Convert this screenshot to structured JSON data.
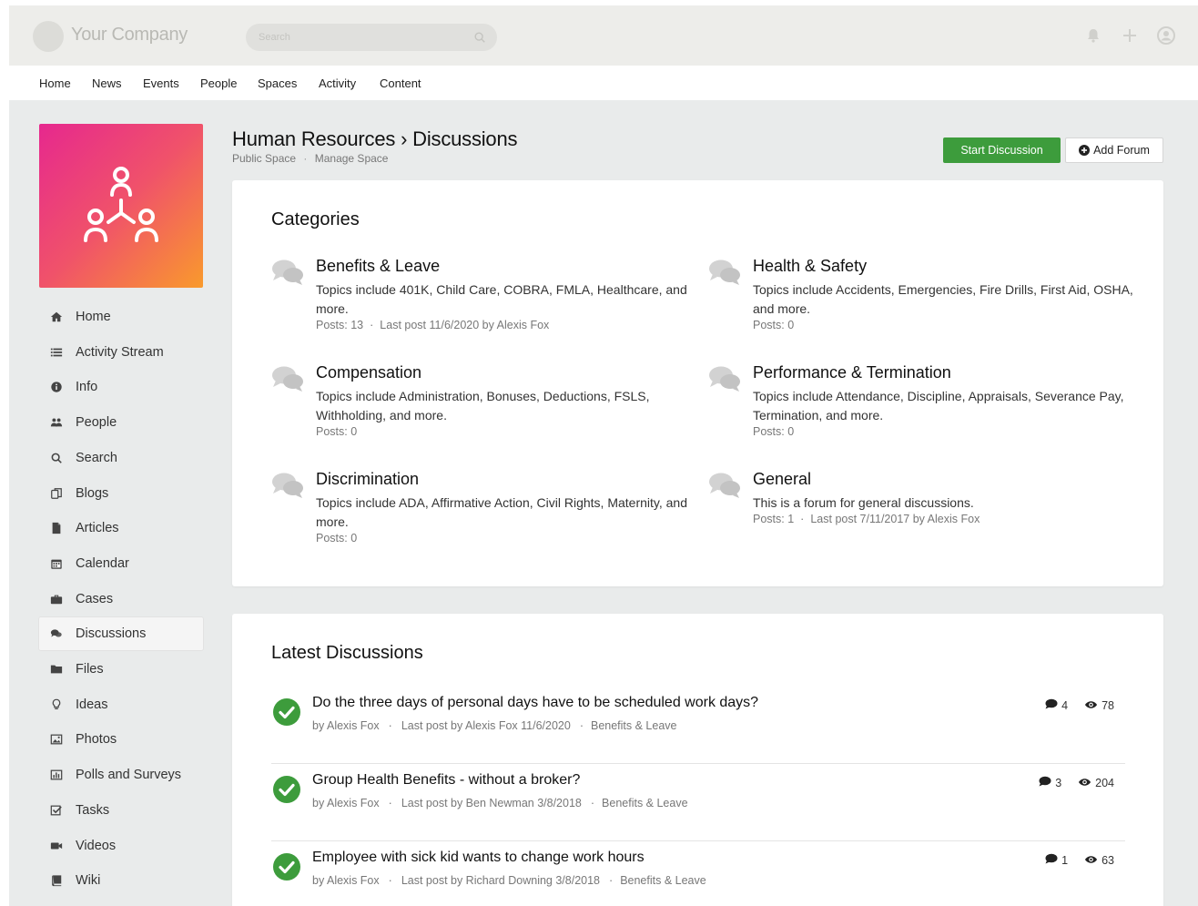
{
  "topbar": {
    "company": "Your Company",
    "search_placeholder": "Search"
  },
  "nav": [
    "Home",
    "News",
    "Events",
    "People",
    "Spaces",
    "Activity",
    "Content"
  ],
  "sidebar": {
    "items": [
      {
        "label": "Home",
        "icon": "home-icon"
      },
      {
        "label": "Activity Stream",
        "icon": "list-icon"
      },
      {
        "label": "Info",
        "icon": "info-icon"
      },
      {
        "label": "People",
        "icon": "people-icon"
      },
      {
        "label": "Search",
        "icon": "search-icon"
      },
      {
        "label": "Blogs",
        "icon": "blog-icon"
      },
      {
        "label": "Articles",
        "icon": "article-icon"
      },
      {
        "label": "Calendar",
        "icon": "calendar-icon"
      },
      {
        "label": "Cases",
        "icon": "briefcase-icon"
      },
      {
        "label": "Discussions",
        "icon": "comments-icon"
      },
      {
        "label": "Files",
        "icon": "folder-icon"
      },
      {
        "label": "Ideas",
        "icon": "lightbulb-icon"
      },
      {
        "label": "Photos",
        "icon": "image-icon"
      },
      {
        "label": "Polls and Surveys",
        "icon": "bar-chart-icon"
      },
      {
        "label": "Tasks",
        "icon": "checkbox-icon"
      },
      {
        "label": "Videos",
        "icon": "video-icon"
      },
      {
        "label": "Wiki",
        "icon": "book-icon"
      }
    ],
    "active": "Discussions"
  },
  "header": {
    "title": "Human Resources › Discussions",
    "visibility": "Public Space",
    "manage": "Manage Space",
    "start_discussion": "Start Discussion",
    "add_forum": "Add Forum"
  },
  "categories": {
    "title": "Categories",
    "items": [
      {
        "name": "Benefits & Leave",
        "desc": "Topics include 401K, Child Care, COBRA, FMLA, Healthcare, and more.",
        "posts": "Posts: 13",
        "last": "Last post 11/6/2020 by Alexis Fox"
      },
      {
        "name": "Health & Safety",
        "desc": "Topics include Accidents, Emergencies, Fire Drills, First Aid, OSHA, and more.",
        "posts": "Posts: 0",
        "last": ""
      },
      {
        "name": "Compensation",
        "desc": "Topics include Administration, Bonuses, Deductions, FSLS, Withholding, and more.",
        "posts": "Posts: 0",
        "last": ""
      },
      {
        "name": "Performance & Termination",
        "desc": "Topics include Attendance, Discipline, Appraisals, Severance Pay, Termination, and more.",
        "posts": "Posts: 0",
        "last": ""
      },
      {
        "name": "Discrimination",
        "desc": "Topics include ADA, Affirmative Action, Civil Rights, Maternity, and more.",
        "posts": "Posts: 0",
        "last": ""
      },
      {
        "name": "General",
        "desc": "This is a forum for general discussions.",
        "posts": "Posts: 1",
        "last": "Last post 7/11/2017 by Alexis Fox"
      }
    ]
  },
  "latest": {
    "title": "Latest Discussions",
    "items": [
      {
        "title": "Do the three days of personal days have to be scheduled work days?",
        "author": "by Alexis Fox",
        "last": "Last post by Alexis Fox 11/6/2020",
        "category": "Benefits & Leave",
        "replies": "4",
        "views": "78"
      },
      {
        "title": "Group Health Benefits - without a broker?",
        "author": "by Alexis Fox",
        "last": "Last post by Ben Newman 3/8/2018",
        "category": "Benefits & Leave",
        "replies": "3",
        "views": "204"
      },
      {
        "title": "Employee with sick kid wants to change work hours",
        "author": "by Alexis Fox",
        "last": "Last post by Richard Downing 3/8/2018",
        "category": "Benefits & Leave",
        "replies": "1",
        "views": "63"
      }
    ]
  },
  "colors": {
    "accent_green": "#3d9c3c",
    "tile_gradient_start": "#e6288e",
    "tile_gradient_end": "#f99a2c"
  }
}
